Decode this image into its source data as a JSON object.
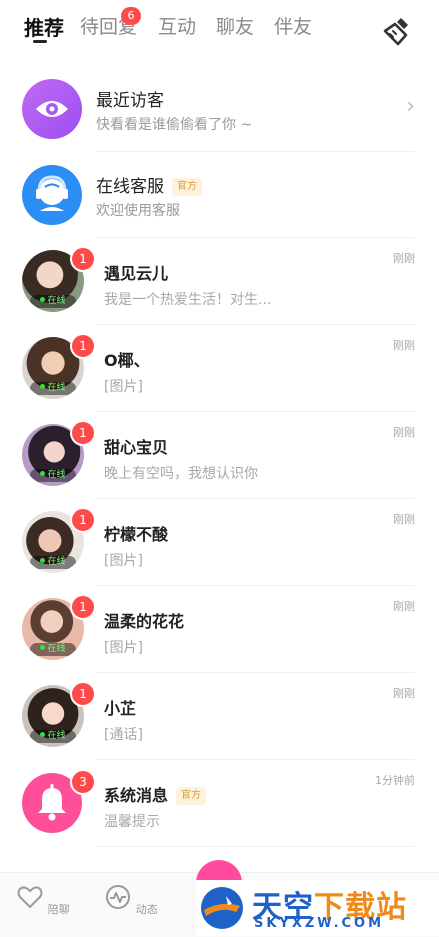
{
  "tabs": [
    {
      "label": "推荐",
      "active": true
    },
    {
      "label": "待回复",
      "badge": "6"
    },
    {
      "label": "互动"
    },
    {
      "label": "聊友"
    },
    {
      "label": "伴友"
    }
  ],
  "visitors": {
    "title": "最近访客",
    "subtitle": "快看看是谁偷偷看了你 ~",
    "icon": "eye-icon",
    "color": "#a65cf2"
  },
  "service": {
    "title": "在线客服",
    "tag": "官方",
    "subtitle": "欢迎使用客服",
    "icon": "headset-agent-icon",
    "color": "#2b8ef5"
  },
  "conversations": [
    {
      "name": "遇见云儿",
      "message": "我是一个热爱生活！对生...",
      "time": "刚刚",
      "unread": "1",
      "status": "在线"
    },
    {
      "name": "O椰、",
      "message": "[图片]",
      "time": "刚刚",
      "unread": "1",
      "status": "在线"
    },
    {
      "name": "甜心宝贝",
      "message": "晚上有空吗，我想认识你",
      "time": "刚刚",
      "unread": "1",
      "status": "在线"
    },
    {
      "name": "柠檬不酸",
      "message": "[图片]",
      "time": "刚刚",
      "unread": "1",
      "status": "在线"
    },
    {
      "name": "温柔的花花",
      "message": "[图片]",
      "time": "刚刚",
      "unread": "1",
      "status": "在线"
    },
    {
      "name": "小芷",
      "message": "[通话]",
      "time": "刚刚",
      "unread": "1",
      "status": "在线"
    }
  ],
  "system": {
    "title": "系统消息",
    "tag": "官方",
    "subtitle": "温馨提示",
    "time": "1分钟前",
    "unread": "3",
    "icon": "bell-icon",
    "color": "#ff4f9a"
  },
  "bottom_nav": [
    {
      "label": "陪聊",
      "icon": "heart-icon"
    },
    {
      "label": "动态",
      "icon": "activity-icon"
    }
  ],
  "watermark": {
    "main": "天空",
    "accent": "下载站",
    "sub": "SKYXZW.COM"
  }
}
